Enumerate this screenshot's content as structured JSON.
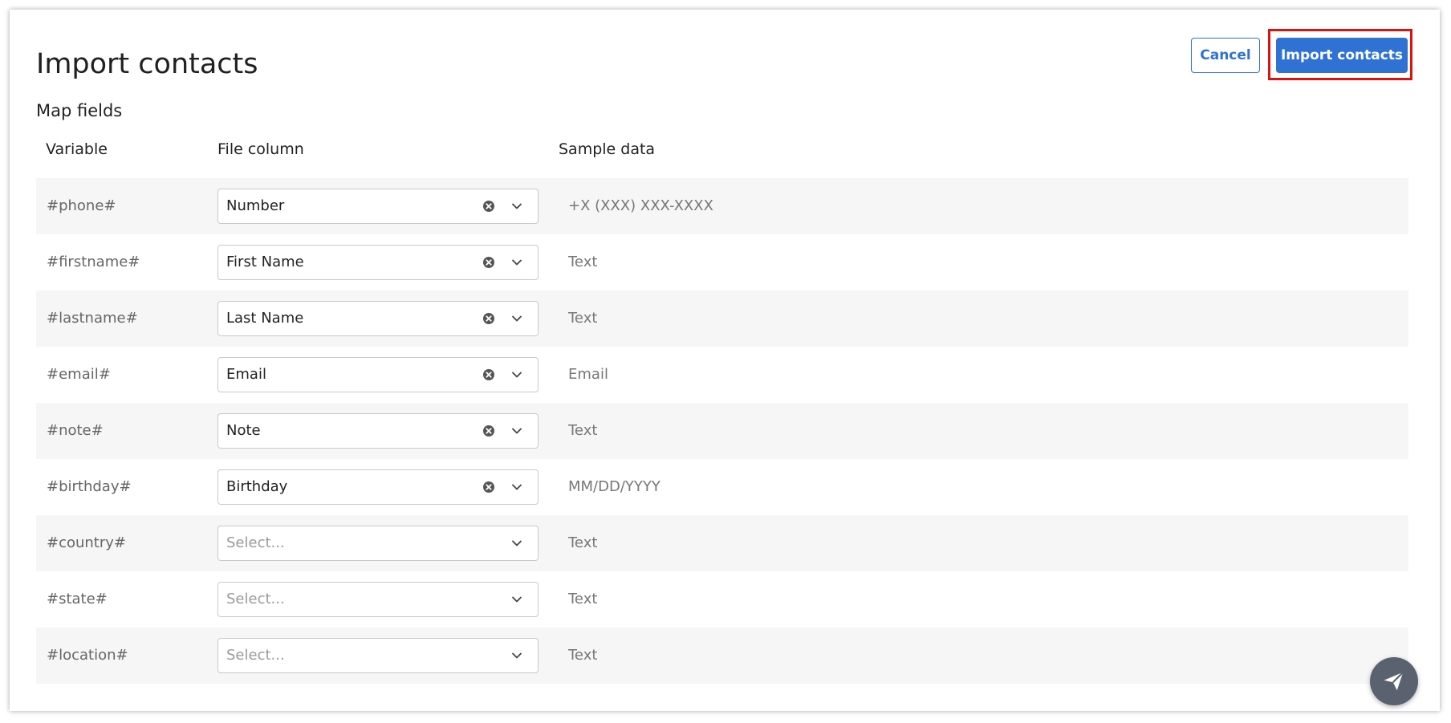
{
  "page": {
    "title": "Import contacts",
    "section_title": "Map fields"
  },
  "buttons": {
    "cancel_label": "Cancel",
    "import_label": "Import contacts"
  },
  "table": {
    "headers": [
      "Variable",
      "File column",
      "Sample data"
    ],
    "rows": [
      {
        "variable": "#phone#",
        "column": "Number",
        "placeholder": false,
        "sample": "+X (XXX) XXX-XXXX"
      },
      {
        "variable": "#firstname#",
        "column": "First Name",
        "placeholder": false,
        "sample": "Text"
      },
      {
        "variable": "#lastname#",
        "column": "Last Name",
        "placeholder": false,
        "sample": "Text"
      },
      {
        "variable": "#email#",
        "column": "Email",
        "placeholder": false,
        "sample": "Email"
      },
      {
        "variable": "#note#",
        "column": "Note",
        "placeholder": false,
        "sample": "Text"
      },
      {
        "variable": "#birthday#",
        "column": "Birthday",
        "placeholder": false,
        "sample": "MM/DD/YYYY"
      },
      {
        "variable": "#country#",
        "column": "Select...",
        "placeholder": true,
        "sample": "Text"
      },
      {
        "variable": "#state#",
        "column": "Select...",
        "placeholder": true,
        "sample": "Text"
      },
      {
        "variable": "#location#",
        "column": "Select...",
        "placeholder": true,
        "sample": "Text"
      }
    ]
  },
  "icons": {
    "clear": "clear-circle-icon",
    "chevron": "chevron-down-icon",
    "chat": "paper-plane-icon"
  },
  "colors": {
    "accent": "#2f72d4",
    "highlight": "#e01010",
    "row_shade": "#f6f6f6",
    "fab": "#5a6270"
  }
}
